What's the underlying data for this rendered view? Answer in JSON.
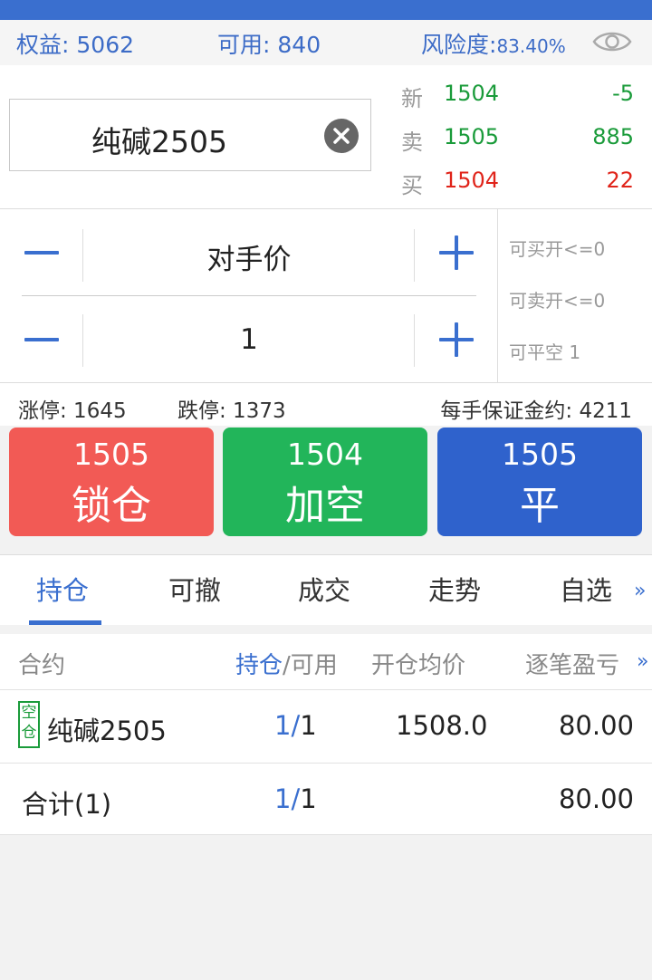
{
  "account": {
    "equity_label": "权益:",
    "equity_value": "5062",
    "available_label": "可用:",
    "available_value": "840",
    "risk_label": "风险度:",
    "risk_value": "83.40%"
  },
  "symbol": {
    "name": "纯碱2505"
  },
  "quote": {
    "rows": [
      {
        "label": "新",
        "price": "1504",
        "value": "-5"
      },
      {
        "label": "卖",
        "price": "1505",
        "value": "885"
      },
      {
        "label": "买",
        "price": "1504",
        "value": "22"
      }
    ]
  },
  "order": {
    "price_type": "对手价",
    "quantity": "1",
    "can_buy_open": "可买开<=0",
    "can_sell_open": "可卖开<=0",
    "can_close_short": "可平空 1"
  },
  "limits": {
    "limit_up": "涨停: 1645",
    "limit_down": "跌停: 1373",
    "margin": "每手保证金约: 4211"
  },
  "buttons": [
    {
      "price": "1505",
      "label": "锁仓",
      "color": "#f25a55"
    },
    {
      "price": "1504",
      "label": "加空",
      "color": "#22b55a"
    },
    {
      "price": "1505",
      "label": "平",
      "color": "#2f62cc"
    }
  ],
  "tabs": [
    "持仓",
    "可撤",
    "成交",
    "走势",
    "自选"
  ],
  "tabs_more": "»",
  "table": {
    "headers": {
      "contract": "合约",
      "position": "持仓",
      "available": "/可用",
      "avg_price": "开仓均价",
      "pnl": "逐笔盈亏",
      "more": "»"
    },
    "row": {
      "tag_top": "空",
      "tag_bottom": "仓",
      "contract": "纯碱2505",
      "position": "1",
      "sep": "/",
      "available": "1",
      "avg_price": "1508.0",
      "pnl": "80.00"
    },
    "total": {
      "label": "合计(1)",
      "position": "1",
      "sep": "/",
      "available": "1",
      "pnl": "80.00"
    }
  },
  "colors": {
    "accent": "#3a6fcf",
    "up_green": "#1a9b3a",
    "down_red": "#e0241a"
  }
}
